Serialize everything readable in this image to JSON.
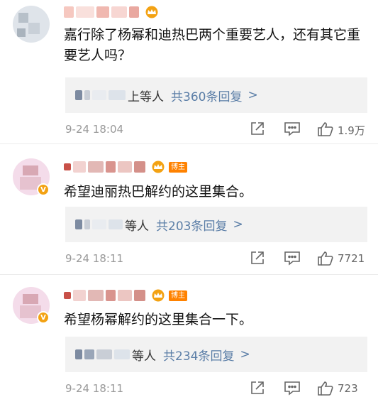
{
  "comments": [
    {
      "text": "嘉行除了杨幂和迪热巴两个重要艺人，还有其它重要艺人吗？",
      "reply_who": "上等人",
      "reply_count": "共360条回复",
      "reply_arrow": ">",
      "date": "9-24 18:04",
      "likes": "1.9万"
    },
    {
      "badge_label": "博主",
      "text": "希望迪丽热巴解约的这里集合。",
      "reply_who": "等人",
      "reply_count": "共203条回复",
      "reply_arrow": ">",
      "date": "9-24 18:11",
      "likes": "7721"
    },
    {
      "badge_label": "博主",
      "text": "希望杨幂解约的这里集合一下。",
      "reply_who": "等人",
      "reply_count": "共234条回复",
      "reply_arrow": ">",
      "date": "9-24 18:11",
      "likes": "723"
    }
  ],
  "icons": [
    "share-icon",
    "comment-icon",
    "like-icon",
    "crown-icon",
    "verified-badge-icon"
  ],
  "colors": {
    "link": "#5b7ea7",
    "badge": "#ff8200",
    "crown": "#f3a213",
    "reply_bg": "#f2f2f2"
  }
}
